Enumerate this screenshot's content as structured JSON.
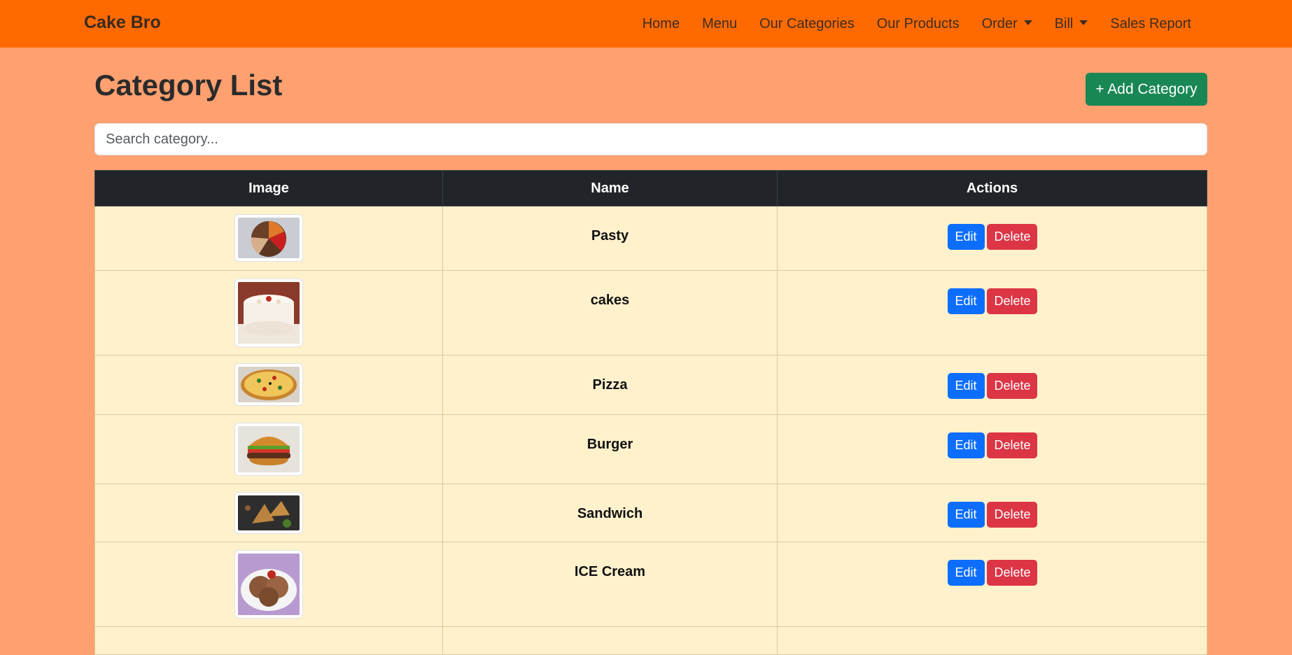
{
  "navbar": {
    "brand": "Cake Bro",
    "links": [
      {
        "label": "Home"
      },
      {
        "label": "Menu"
      },
      {
        "label": "Our Categories"
      },
      {
        "label": "Our Products"
      },
      {
        "label": "Order",
        "dropdown": true
      },
      {
        "label": "Bill",
        "dropdown": true
      },
      {
        "label": "Sales Report"
      }
    ],
    "bg_color": "#ff6a00"
  },
  "page": {
    "title": "Category List",
    "add_button_label": "+ Add Category",
    "search_placeholder": "Search category...",
    "bg_color": "#ffa070"
  },
  "table": {
    "headers": [
      "Image",
      "Name",
      "Actions"
    ],
    "rows": [
      {
        "name": "Pasty",
        "image_icon": "pastry-image"
      },
      {
        "name": "cakes",
        "image_icon": "cake-image"
      },
      {
        "name": "Pizza",
        "image_icon": "pizza-image"
      },
      {
        "name": "Burger",
        "image_icon": "burger-image"
      },
      {
        "name": "Sandwich",
        "image_icon": "sandwich-image"
      },
      {
        "name": "ICE Cream",
        "image_icon": "ice-cream-image"
      }
    ],
    "edit_label": "Edit",
    "delete_label": "Delete"
  }
}
